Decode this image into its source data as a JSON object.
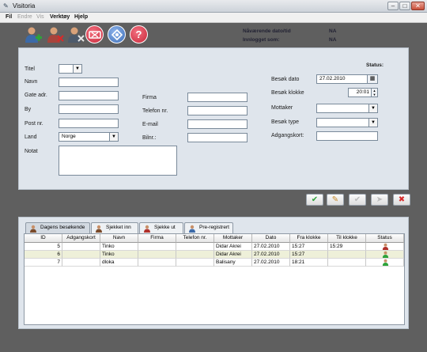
{
  "window": {
    "title": "Visitoria",
    "minimize": "–",
    "maximize": "□",
    "close": "✕"
  },
  "menu": [
    {
      "label": "Fil",
      "enabled": true
    },
    {
      "label": "Endre",
      "enabled": false
    },
    {
      "label": "Vis",
      "enabled": false
    },
    {
      "label": "Verktøy",
      "enabled": true
    },
    {
      "label": "Hjelp",
      "enabled": true
    }
  ],
  "toolbar": {
    "icons": [
      "add-user-icon",
      "remove-user-icon",
      "edit-user-icon",
      "cancel-visit-icon",
      "refresh-icon",
      "help-icon"
    ],
    "current_datetime_label": "Nåværende dato/tid",
    "current_datetime_value": "NA",
    "logged_in_label": "Innlogget som:",
    "logged_in_value": "NA"
  },
  "form": {
    "status_label": "Status:",
    "title_label": "Titel",
    "title_value": "",
    "name_label": "Navn",
    "street_label": "Gate adr.",
    "city_label": "By",
    "postal_label": "Post nr.",
    "country_label": "Land",
    "country_value": "Norge",
    "note_label": "Notat",
    "company_label": "Firma",
    "phone_label": "Telefon nr.",
    "email_label": "E-mail",
    "car_label": "Bilnr.:",
    "visit_date_label": "Besøk dato",
    "visit_date_value": "27.02.2010",
    "visit_time_label": "Besøk klokke",
    "visit_time_value": "20:01",
    "receiver_label": "Mottaker",
    "visit_type_label": "Besøk type",
    "access_card_label": "Adgangskort:"
  },
  "actions": {
    "confirm_icon": "checkmark-icon",
    "edit_icon": "pencil-icon",
    "disabled1_icon": "check-disabled-icon",
    "disabled2_icon": "arrow-disabled-icon",
    "delete_icon": "delete-icon",
    "confirm": "✔",
    "edit": "✎",
    "disabled1": "✔",
    "disabled2": "➤",
    "delete": "✖"
  },
  "tabs": [
    {
      "label": "Dagens besøkende",
      "active": true
    },
    {
      "label": "Sjekket inn",
      "active": false
    },
    {
      "label": "Sjekke ut",
      "active": false
    },
    {
      "label": "Pre-registrert",
      "active": false
    }
  ],
  "table": {
    "columns": [
      "ID",
      "Adgangskort",
      "Navn",
      "Firma",
      "Telefon nr.",
      "Mottaker",
      "Dato",
      "Fra klokke",
      "Til klokke",
      "Status"
    ],
    "rows": [
      {
        "id": "5",
        "card": "",
        "name": "Tinko",
        "company": "",
        "phone": "",
        "receiver": "Didar Akrei",
        "date": "27.02.2010",
        "from": "15:27",
        "to": "15:29",
        "status": "checked-out-icon"
      },
      {
        "id": "6",
        "card": "",
        "name": "Tinko",
        "company": "",
        "phone": "",
        "receiver": "Didar Akrei",
        "date": "27.02.2010",
        "from": "15:27",
        "to": "",
        "status": "checked-in-icon"
      },
      {
        "id": "7",
        "card": "",
        "name": "dloka",
        "company": "",
        "phone": "",
        "receiver": "Balisany",
        "date": "27.02.2010",
        "from": "18:21",
        "to": "",
        "status": "checked-in-icon"
      }
    ]
  },
  "colors": {
    "background": "#5f5f5f",
    "panel": "#dfe5ec",
    "row_alt": "#eef0d9",
    "red_button": "#c8283a",
    "blue_button": "#3d6fb8"
  }
}
